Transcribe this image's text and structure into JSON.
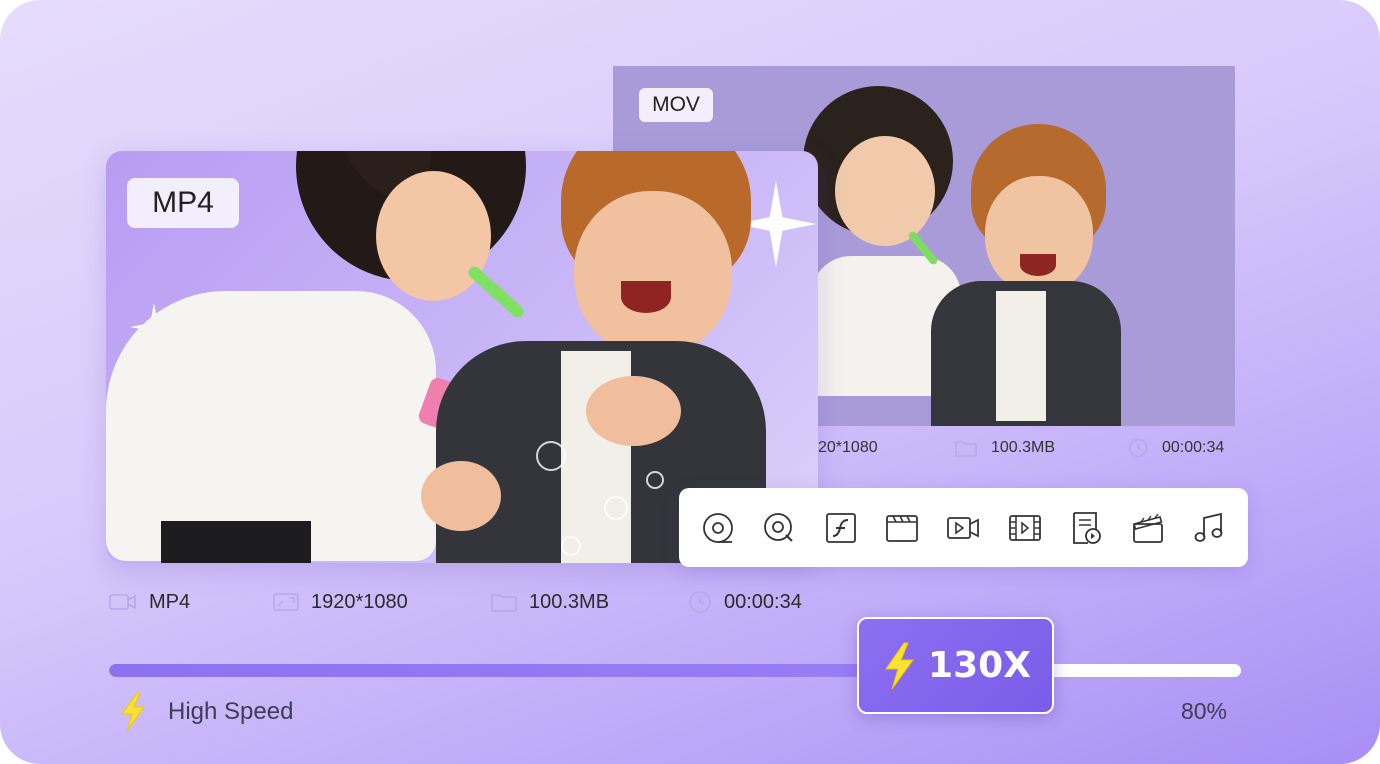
{
  "output": {
    "format_tag": "MOV",
    "resolution": "20*1080",
    "size": "100.3MB",
    "duration": "00:00:34"
  },
  "source": {
    "format_tag": "MP4",
    "format": "MP4",
    "resolution": "1920*1080",
    "size": "100.3MB",
    "duration": "00:00:34"
  },
  "toolbar": {
    "tools": [
      {
        "icon": "dvd-disc-icon"
      },
      {
        "icon": "disc-search-icon"
      },
      {
        "icon": "flash-video-icon"
      },
      {
        "icon": "clapperboard-icon"
      },
      {
        "icon": "video-camera-icon"
      },
      {
        "icon": "film-strip-icon"
      },
      {
        "icon": "playlist-file-icon"
      },
      {
        "icon": "movie-clap-icon"
      },
      {
        "icon": "music-note-icon"
      }
    ]
  },
  "conversion": {
    "speed_label": "130X",
    "mode_label": "High Speed",
    "progress": 0.8,
    "progress_text": "80%"
  },
  "colors": {
    "accent": "#8c72f0",
    "bolt": "#f7e230",
    "badge": "#7b5ce9"
  }
}
